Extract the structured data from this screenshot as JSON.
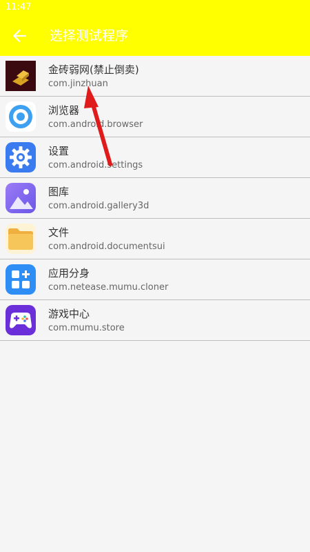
{
  "status": {
    "time": "11:47"
  },
  "header": {
    "title": "选择测试程序"
  },
  "apps": [
    {
      "name": "金砖弱网(禁止倒卖)",
      "package": "com.jinzhuan",
      "icon": "gold-bar-icon"
    },
    {
      "name": "浏览器",
      "package": "com.android.browser",
      "icon": "browser-icon"
    },
    {
      "name": "设置",
      "package": "com.android.settings",
      "icon": "gear-icon"
    },
    {
      "name": "图库",
      "package": "com.android.gallery3d",
      "icon": "gallery-icon"
    },
    {
      "name": "文件",
      "package": "com.android.documentsui",
      "icon": "folder-icon"
    },
    {
      "name": "应用分身",
      "package": "com.netease.mumu.cloner",
      "icon": "app-cloner-icon"
    },
    {
      "name": "游戏中心",
      "package": "com.mumu.store",
      "icon": "gamepad-icon"
    }
  ],
  "colors": {
    "appbar": "#ffff00",
    "annotation_arrow": "#e01b1b"
  }
}
